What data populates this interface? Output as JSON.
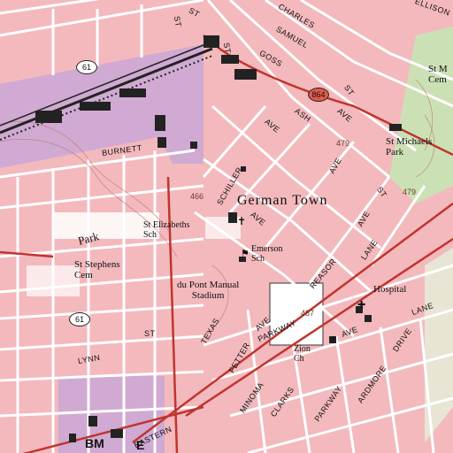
{
  "map": {
    "colors": {
      "urban_tint": "#f3b9bd",
      "park_tint": "#c9a7d6",
      "grid_line": "#ffffff",
      "major_road": "#c0352e",
      "building": "#222222",
      "contour": "#b7776a",
      "green": "#c7e6b4"
    },
    "place_names": {
      "german_town": "German Town",
      "st_michaels_park": "St Michaels\nPark",
      "st_michaels_cem": "St M\nCem",
      "st_elizabeths_sch": "St Elizabeths\nSch",
      "emerson_sch": "Emerson\nSch",
      "dupont_manual": "du Pont Manual\nStadium",
      "hospital": "Hospital",
      "zion_ch": "Zion\nCh",
      "st_stephens_cem": "St Stephens\nCem",
      "park": "Park"
    },
    "street_names": {
      "burnett": "BURNETT",
      "charles": "CHARLES",
      "samuel": "SAMUEL",
      "goss": "GOSS",
      "ellison": "ELLISON",
      "ash": "ASH",
      "schiller": "SCHILLER",
      "texas": "TEXAS",
      "fetter": "FETTER",
      "minoma": "MINOMA",
      "clarks": "CLARKS",
      "parkway": "PARKWAY",
      "parkway2": "PARKWAY",
      "ardmore": "ARDMORE",
      "eastern": "EASTERN",
      "lynn": "LYNN",
      "drive": "DRIVE",
      "lane": "LANE",
      "lane2": "LANE",
      "reasor": "REASOR",
      "st": "ST",
      "ave1": "AVE",
      "ave2": "AVE",
      "ave3": "AVE",
      "ave4": "AVE",
      "ave5": "AVE",
      "ave6": "AVE",
      "ave7": "AVE",
      "st2": "ST",
      "st3": "ST",
      "st4": "ST",
      "st5": "ST",
      "st6": "ST"
    },
    "elevations": {
      "e466": "466",
      "e479a": "479",
      "e479b": "479",
      "e487": "487"
    },
    "routes": {
      "r61a": "61",
      "r61b": "61",
      "r61c": "61",
      "r864": "864"
    },
    "benchmark_letters": {
      "bm": "BM",
      "e": "E"
    }
  }
}
